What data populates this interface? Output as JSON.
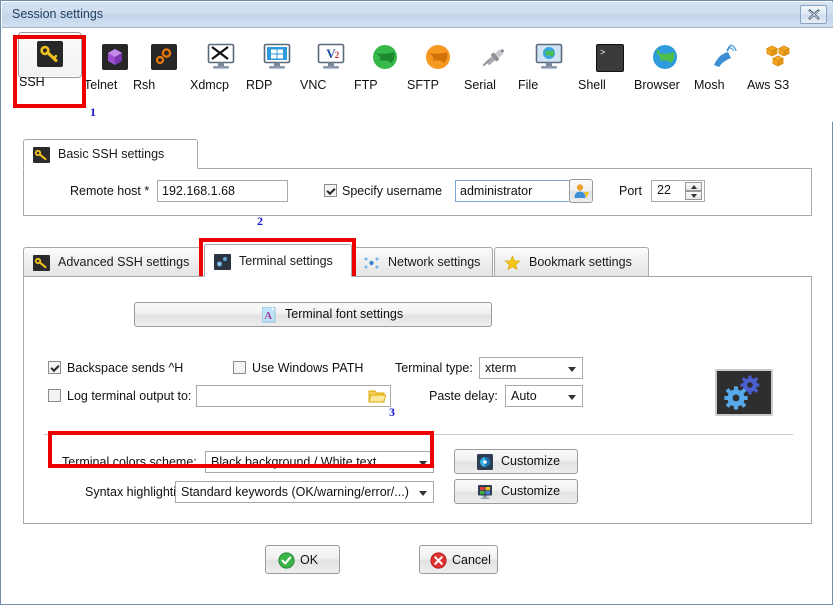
{
  "window": {
    "title": "Session settings",
    "close_label": "close-window"
  },
  "session_types": [
    {
      "label": "SSH",
      "icon": "ssh-key-icon",
      "selected": true
    },
    {
      "label": "Telnet",
      "icon": "telnet-cube-icon",
      "selected": false
    },
    {
      "label": "Rsh",
      "icon": "rsh-gears-icon",
      "selected": false
    },
    {
      "label": "Xdmcp",
      "icon": "xdmcp-monitor-icon",
      "selected": false
    },
    {
      "label": "RDP",
      "icon": "rdp-windows-icon",
      "selected": false
    },
    {
      "label": "VNC",
      "icon": "vnc-monitor-icon",
      "selected": false
    },
    {
      "label": "FTP",
      "icon": "ftp-globe-icon",
      "selected": false
    },
    {
      "label": "SFTP",
      "icon": "sftp-globe-icon",
      "selected": false
    },
    {
      "label": "Serial",
      "icon": "serial-plug-icon",
      "selected": false
    },
    {
      "label": "File",
      "icon": "file-monitor-icon",
      "selected": false
    },
    {
      "label": "Shell",
      "icon": "shell-prompt-icon",
      "selected": false
    },
    {
      "label": "Browser",
      "icon": "browser-globe-icon",
      "selected": false
    },
    {
      "label": "Mosh",
      "icon": "mosh-satellite-icon",
      "selected": false
    },
    {
      "label": "Aws S3",
      "icon": "aws-s3-boxes-icon",
      "selected": false
    }
  ],
  "basic_ssh": {
    "tab_label": "Basic SSH settings",
    "remote_host_label": "Remote host *",
    "remote_host_value": "192.168.1.68",
    "specify_username_label": "Specify username",
    "specify_username_checked": true,
    "username_value": "administrator",
    "user_picker_icon": "user-select-icon",
    "port_label": "Port",
    "port_value": "22"
  },
  "settings_tabs": [
    {
      "label": "Advanced SSH settings",
      "icon": "key-icon",
      "active": false
    },
    {
      "label": "Terminal settings",
      "icon": "terminal-icon",
      "active": true
    },
    {
      "label": "Network settings",
      "icon": "network-icon",
      "active": false
    },
    {
      "label": "Bookmark settings",
      "icon": "star-icon",
      "active": false
    }
  ],
  "terminal_settings": {
    "font_button_label": "Terminal font settings",
    "font_button_icon": "font-a-icon",
    "backspace_label": "Backspace sends ^H",
    "backspace_checked": true,
    "windows_path_label": "Use Windows PATH",
    "windows_path_checked": false,
    "log_output_label": "Log terminal output to:",
    "log_output_checked": false,
    "log_output_value": "",
    "browse_icon": "folder-open-icon",
    "terminal_type_label": "Terminal type:",
    "terminal_type_value": "xterm",
    "paste_delay_label": "Paste delay:",
    "paste_delay_value": "Auto",
    "preview_icon": "terminal-gears-icon",
    "colors_scheme_label": "Terminal colors scheme:",
    "colors_scheme_value": "Black background / White text",
    "colors_customize_label": "Customize",
    "colors_customize_icon": "color-wheel-icon",
    "syntax_label": "Syntax highlighting:",
    "syntax_value": "Standard keywords (OK/warning/error/...)",
    "syntax_customize_label": "Customize",
    "syntax_customize_icon": "syntax-colors-icon"
  },
  "footer": {
    "ok_label": "OK",
    "ok_icon": "check-circle-icon",
    "cancel_label": "Cancel",
    "cancel_icon": "x-circle-icon"
  },
  "annotations": {
    "markers": [
      "1",
      "2",
      "3"
    ],
    "highlight_color": "#ee0000"
  }
}
